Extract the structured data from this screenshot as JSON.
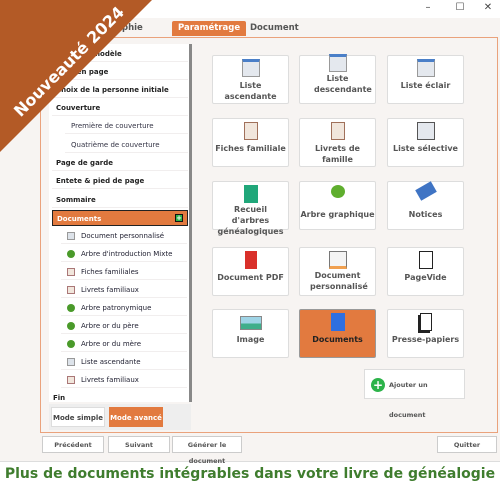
{
  "window": {
    "controls": [
      "–",
      "☐",
      "✕"
    ]
  },
  "tabs": [
    {
      "label": "graphie"
    },
    {
      "label": "Paramétrage",
      "active": true
    },
    {
      "label": "Document"
    }
  ],
  "sidebar": {
    "items": [
      {
        "label": "Choix du modèle"
      },
      {
        "label": "Mise en page"
      },
      {
        "label": "Choix de la personne initiale"
      },
      {
        "label": "Couverture"
      },
      {
        "label": "Première de couverture"
      },
      {
        "label": "Quatrième de couverture"
      },
      {
        "label": "Page de garde"
      },
      {
        "label": "Entete & pied de page"
      },
      {
        "label": "Sommaire"
      },
      {
        "label": "Documents"
      },
      {
        "label": "Fin"
      }
    ],
    "documents": [
      {
        "label": "Document personnalisé",
        "icon": "document-icon"
      },
      {
        "label": "Arbre d'introduction Mixte",
        "icon": "tree-icon"
      },
      {
        "label": "Fiches familiales",
        "icon": "card-icon"
      },
      {
        "label": "Livrets familiaux",
        "icon": "card-icon"
      },
      {
        "label": "Arbre patronymique",
        "icon": "tree-icon"
      },
      {
        "label": "Arbre or du père",
        "icon": "tree-icon"
      },
      {
        "label": "Arbre or du mère",
        "icon": "tree-icon"
      },
      {
        "label": "Liste ascendante",
        "icon": "list-icon"
      },
      {
        "label": "Livrets familiaux",
        "icon": "card-icon"
      }
    ],
    "mode_simple": "Mode simple",
    "mode_avance": "Mode avancé"
  },
  "grid": [
    {
      "label": "Liste ascendante"
    },
    {
      "label": "Liste descendante"
    },
    {
      "label": "Liste éclair"
    },
    {
      "label": "Fiches familiale"
    },
    {
      "label": "Livrets de famille"
    },
    {
      "label": "Liste sélective"
    },
    {
      "label": "Recueil d'arbres généalogiques"
    },
    {
      "label": "Arbre graphique"
    },
    {
      "label": "Notices"
    },
    {
      "label": "Document PDF"
    },
    {
      "label": "Document personnalisé"
    },
    {
      "label": "PageVide"
    },
    {
      "label": "Image"
    },
    {
      "label": "Documents",
      "selected": true
    },
    {
      "label": "Presse-papiers"
    }
  ],
  "add_document": "Ajouter un document",
  "footer_buttons": {
    "prev": "Précédent",
    "next": "Suivant",
    "generate": "Générer le document",
    "quit": "Quitter"
  },
  "banner": "Nouveauté 2024",
  "tagline": "Plus de documents intégrables dans votre livre de généalogie",
  "colors": {
    "accent": "#e27a3f",
    "banner": "#b35a26",
    "tagline": "#3f7d2e"
  }
}
